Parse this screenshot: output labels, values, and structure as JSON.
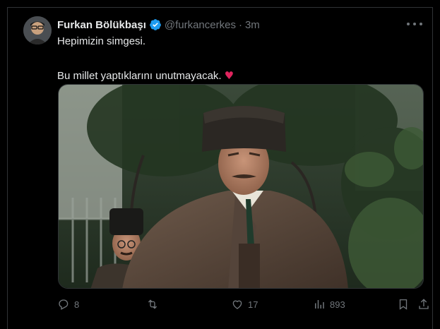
{
  "tweet": {
    "author_name": "Furkan Bölükbaşı",
    "handle": "@furkancerkes",
    "separator": "·",
    "time": "3m",
    "line1": "Hepimizin simgesi.",
    "line2": "Bu millet yaptıklarını unutmayacak.",
    "emoji": "♥"
  },
  "actions": {
    "replies": "8",
    "likes": "17",
    "views": "893"
  },
  "icons": {
    "reply": "reply-icon",
    "retweet": "retweet-icon",
    "like": "heart-icon",
    "views": "views-icon",
    "bookmark": "bookmark-icon",
    "share": "share-icon",
    "more": "more-icon",
    "verified": "verified-badge-icon"
  },
  "colors": {
    "background": "#000000",
    "text": "#e7e9ea",
    "secondary": "#71767b",
    "verified": "#1d9bf0",
    "heart_emoji": "#e0245e"
  }
}
